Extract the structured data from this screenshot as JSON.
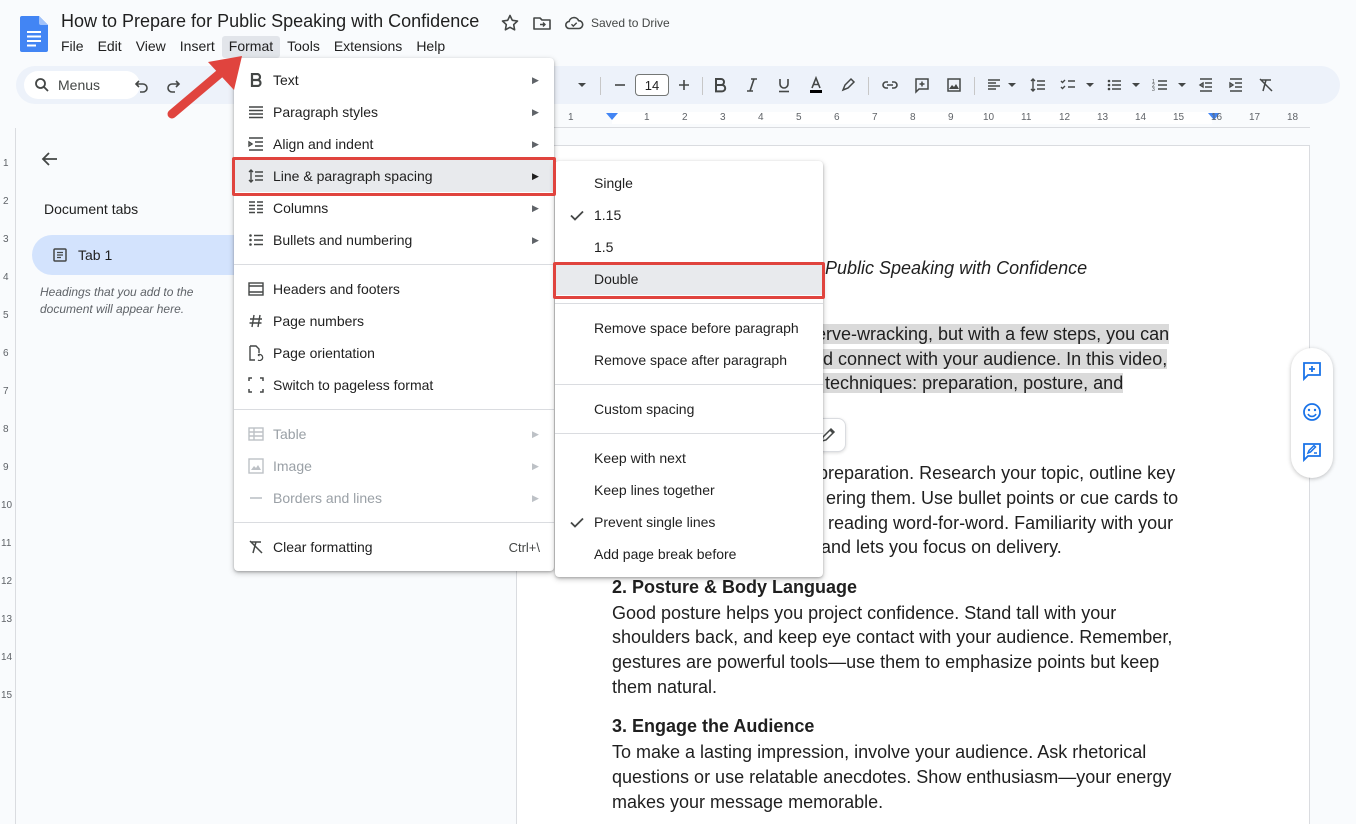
{
  "document": {
    "title": "How to Prepare for Public Speaking with Confidence",
    "save_status": "Saved to Drive"
  },
  "menubar": [
    "File",
    "Edit",
    "View",
    "Insert",
    "Format",
    "Tools",
    "Extensions",
    "Help"
  ],
  "active_menu": "Format",
  "toolbar": {
    "search_label": "Menus",
    "font_size": "14"
  },
  "left_pane": {
    "heading": "Document tabs",
    "tab_label": "Tab 1",
    "hint": "Headings that you add to the document will appear here."
  },
  "ruler": {
    "h_numbers": [
      "1",
      "1",
      "2",
      "3",
      "4",
      "5",
      "6",
      "7",
      "8",
      "9",
      "10",
      "11",
      "12",
      "13",
      "14",
      "15",
      "16",
      "17",
      "18"
    ],
    "v_numbers": [
      "1",
      "2",
      "3",
      "4",
      "5",
      "6",
      "7",
      "8",
      "9",
      "10",
      "11",
      "12",
      "13",
      "14",
      "15"
    ]
  },
  "doc_body": {
    "title_fragment": "Public Speaking with Confidence",
    "intro_lines": [
      "erve-wracking, but with a few steps, you can",
      "d connect with your audience. In this video,",
      "l techniques: preparation, posture, and"
    ],
    "section1_lines": [
      "preparation. Research your topic, outline key",
      "ering them. Use bullet points or cue cards to",
      "reading word-for-word. Familiarity with your",
      "and lets you focus on delivery."
    ],
    "section2_heading": "2. Posture & Body Language",
    "section2_lines": [
      "Good posture helps you project confidence. Stand tall with your",
      "shoulders back, and keep eye contact with your audience. Remember,",
      "gestures are powerful tools—use them to emphasize points but keep",
      "them natural."
    ],
    "section3_heading": "3. Engage the Audience",
    "section3_lines": [
      "To make a lasting impression, involve your audience. Ask rhetorical",
      "questions or use relatable anecdotes. Show enthusiasm—your energy",
      "makes your message memorable."
    ]
  },
  "format_menu": {
    "items": [
      {
        "label": "Text",
        "icon": "bold-icon",
        "submenu": true
      },
      {
        "label": "Paragraph styles",
        "icon": "paragraph-styles-icon",
        "submenu": true
      },
      {
        "label": "Align and indent",
        "icon": "align-indent-icon",
        "submenu": true
      },
      {
        "label": "Line & paragraph spacing",
        "icon": "line-spacing-icon",
        "submenu": true,
        "highlighted": true
      },
      {
        "label": "Columns",
        "icon": "columns-icon",
        "submenu": true
      },
      {
        "label": "Bullets and numbering",
        "icon": "bullets-icon",
        "submenu": true
      },
      {
        "label": "Headers and footers",
        "icon": "headers-footers-icon"
      },
      {
        "label": "Page numbers",
        "icon": "page-numbers-icon"
      },
      {
        "label": "Page orientation",
        "icon": "page-orientation-icon"
      },
      {
        "label": "Switch to pageless format",
        "icon": "pageless-icon"
      },
      {
        "label": "Table",
        "icon": "table-icon",
        "submenu": true,
        "disabled": true
      },
      {
        "label": "Image",
        "icon": "image-icon",
        "submenu": true,
        "disabled": true
      },
      {
        "label": "Borders and lines",
        "icon": "borders-icon",
        "submenu": true,
        "disabled": true
      },
      {
        "label": "Clear formatting",
        "icon": "clear-formatting-icon",
        "shortcut": "Ctrl+\\"
      }
    ]
  },
  "spacing_menu": {
    "items": [
      {
        "label": "Single",
        "checked": false
      },
      {
        "label": "1.15",
        "checked": true
      },
      {
        "label": "1.5",
        "checked": false
      },
      {
        "label": "Double",
        "checked": false,
        "highlighted": true
      },
      {
        "label": "Remove space before paragraph"
      },
      {
        "label": "Remove space after paragraph"
      },
      {
        "label": "Custom spacing"
      },
      {
        "label": "Keep with next"
      },
      {
        "label": "Keep lines together"
      },
      {
        "label": "Prevent single lines",
        "checked": true
      },
      {
        "label": "Add page break before"
      }
    ]
  },
  "colors": {
    "accent": "#1a73e8",
    "annotation_red": "#e0443e",
    "tab_active_bg": "#d3e3fd",
    "selection_gray": "#dadada"
  }
}
